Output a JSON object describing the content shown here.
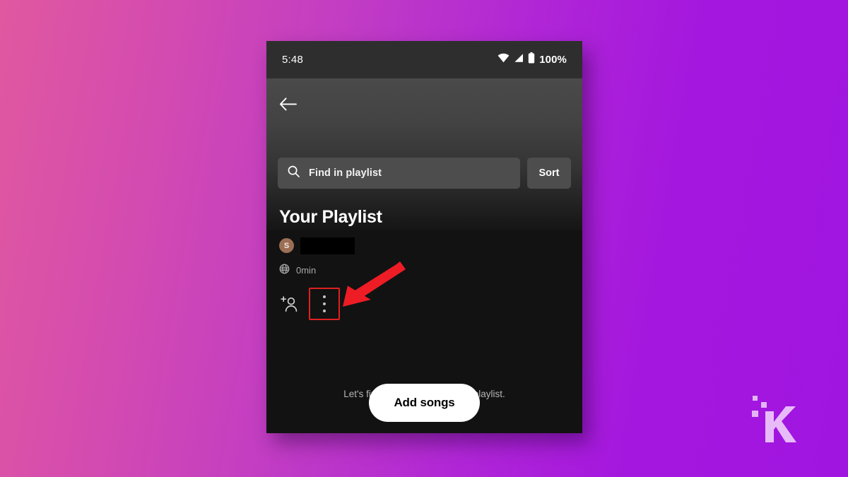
{
  "background": {
    "gradient_from": "#e0589f",
    "gradient_to": "#a016e0"
  },
  "phone": {
    "status_bar": {
      "time": "5:48",
      "battery_percent": "100%",
      "icons": [
        "wifi-icon",
        "cellular-signal-icon",
        "battery-icon"
      ]
    },
    "header": {
      "back_label": "Back",
      "search": {
        "placeholder": "Find in playlist",
        "value": "",
        "icon": "search-icon"
      },
      "sort_label": "Sort"
    },
    "playlist": {
      "title": "Your Playlist",
      "owner_initial": "S",
      "owner_name_redacted": "",
      "visibility_icon": "globe-icon",
      "duration": "0min",
      "actions": {
        "add_user_icon": "add-person-icon",
        "more_icon": "three-dot-menu-icon"
      }
    },
    "empty_state": {
      "message": "Let's find some songs for your playlist.",
      "button_label": "Add songs"
    }
  },
  "annotation": {
    "arrow_color": "#ee1c25",
    "highlight_color": "#e02020",
    "points_to": "three-dot-menu-icon"
  },
  "watermark": {
    "letter": "K",
    "color": "#e3b6f5"
  }
}
